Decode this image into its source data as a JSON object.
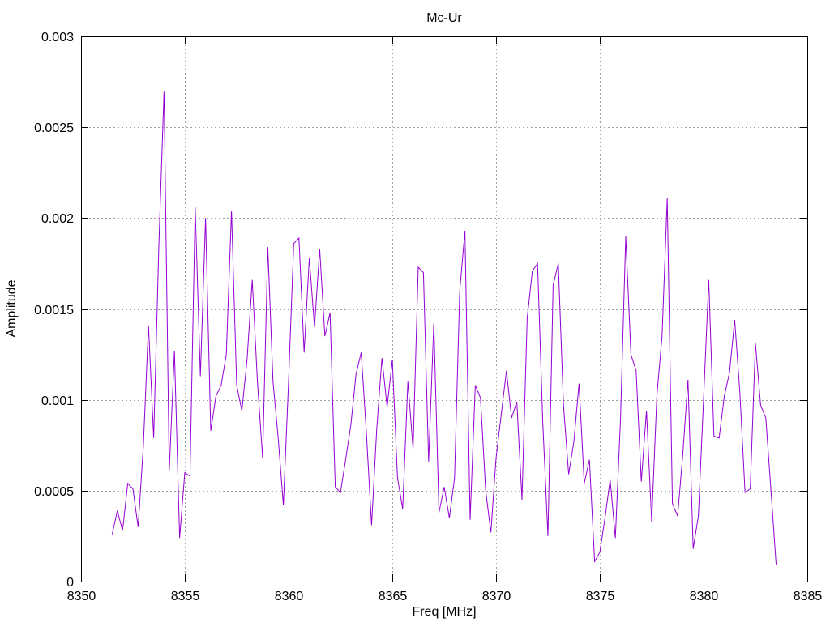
{
  "chart_data": {
    "type": "line",
    "title": "Mc-Ur",
    "xlabel": "Freq [MHz]",
    "ylabel": "Amplitude",
    "xlim": [
      8350,
      8385
    ],
    "ylim": [
      0,
      0.003
    ],
    "xticks": [
      "8350",
      "8355",
      "8360",
      "8365",
      "8370",
      "8375",
      "8380",
      "8385"
    ],
    "yticks": [
      "0",
      "0.0005",
      "0.001",
      "0.0015",
      "0.002",
      "0.0025",
      "0.003"
    ],
    "grid": true,
    "legend": "none",
    "series": [
      {
        "color": "#9400d3",
        "x": [
          8351.5,
          8351.75,
          8352,
          8352.25,
          8352.5,
          8352.75,
          8353,
          8353.25,
          8353.5,
          8353.75,
          8354,
          8354.25,
          8354.5,
          8354.75,
          8355,
          8355.25,
          8355.5,
          8355.75,
          8356,
          8356.25,
          8356.5,
          8356.75,
          8357,
          8357.25,
          8357.5,
          8357.75,
          8358,
          8358.25,
          8358.5,
          8358.75,
          8359,
          8359.25,
          8359.5,
          8359.75,
          8360,
          8360.25,
          8360.5,
          8360.75,
          8361,
          8361.25,
          8361.5,
          8361.75,
          8362,
          8362.25,
          8362.5,
          8362.75,
          8363,
          8363.25,
          8363.5,
          8363.75,
          8364,
          8364.25,
          8364.5,
          8364.75,
          8365,
          8365.25,
          8365.5,
          8365.75,
          8366,
          8366.25,
          8366.5,
          8366.75,
          8367,
          8367.25,
          8367.5,
          8367.75,
          8368,
          8368.25,
          8368.5,
          8368.75,
          8369,
          8369.25,
          8369.5,
          8369.75,
          8370,
          8370.25,
          8370.5,
          8370.75,
          8371,
          8371.25,
          8371.5,
          8371.75,
          8372,
          8372.25,
          8372.5,
          8372.75,
          8373,
          8373.25,
          8373.5,
          8373.75,
          8374,
          8374.25,
          8374.5,
          8374.75,
          8375,
          8375.25,
          8375.5,
          8375.75,
          8376,
          8376.25,
          8376.5,
          8376.75,
          8377,
          8377.25,
          8377.5,
          8377.75,
          8378,
          8378.25,
          8378.5,
          8378.75,
          8379,
          8379.25,
          8379.5,
          8379.75,
          8380,
          8380.25,
          8380.5,
          8380.75,
          8381,
          8381.25,
          8381.5,
          8381.75,
          8382,
          8382.25,
          8382.5,
          8382.75,
          8383,
          8383.25,
          8383.5
        ],
        "y": [
          0.00026,
          0.00039,
          0.00028,
          0.00054,
          0.00051,
          0.0003,
          0.00074,
          0.00141,
          0.00079,
          0.00185,
          0.0027,
          0.00061,
          0.00127,
          0.00024,
          0.0006,
          0.00058,
          0.00206,
          0.00113,
          0.002,
          0.00083,
          0.00102,
          0.00108,
          0.00125,
          0.00204,
          0.00108,
          0.00094,
          0.00122,
          0.00166,
          0.0011,
          0.00068,
          0.00184,
          0.0011,
          0.00079,
          0.00042,
          0.0011,
          0.00186,
          0.00189,
          0.00126,
          0.00178,
          0.0014,
          0.00183,
          0.00135,
          0.00148,
          0.00052,
          0.00049,
          0.00067,
          0.00086,
          0.00114,
          0.00126,
          0.00082,
          0.00031,
          0.00084,
          0.00123,
          0.00096,
          0.00122,
          0.00057,
          0.0004,
          0.0011,
          0.00073,
          0.00173,
          0.0017,
          0.00066,
          0.00142,
          0.00038,
          0.00052,
          0.00035,
          0.00057,
          0.0016,
          0.00193,
          0.00034,
          0.00108,
          0.00101,
          0.0005,
          0.00027,
          0.00068,
          0.00092,
          0.00116,
          0.0009,
          0.00099,
          0.00045,
          0.00145,
          0.00171,
          0.00175,
          0.00088,
          0.00025,
          0.00163,
          0.00175,
          0.00097,
          0.00059,
          0.00077,
          0.00109,
          0.00054,
          0.00067,
          0.00011,
          0.00016,
          0.00035,
          0.00056,
          0.00024,
          0.0009,
          0.0019,
          0.00125,
          0.00116,
          0.00055,
          0.00094,
          0.00033,
          0.00102,
          0.00135,
          0.00211,
          0.00043,
          0.00036,
          0.0007,
          0.00111,
          0.00018,
          0.00036,
          0.001,
          0.00166,
          0.0008,
          0.00079,
          0.00102,
          0.00115,
          0.00144,
          0.00104,
          0.00049,
          0.00051,
          0.00131,
          0.00097,
          0.0009,
          0.0005,
          9e-05
        ]
      }
    ]
  }
}
